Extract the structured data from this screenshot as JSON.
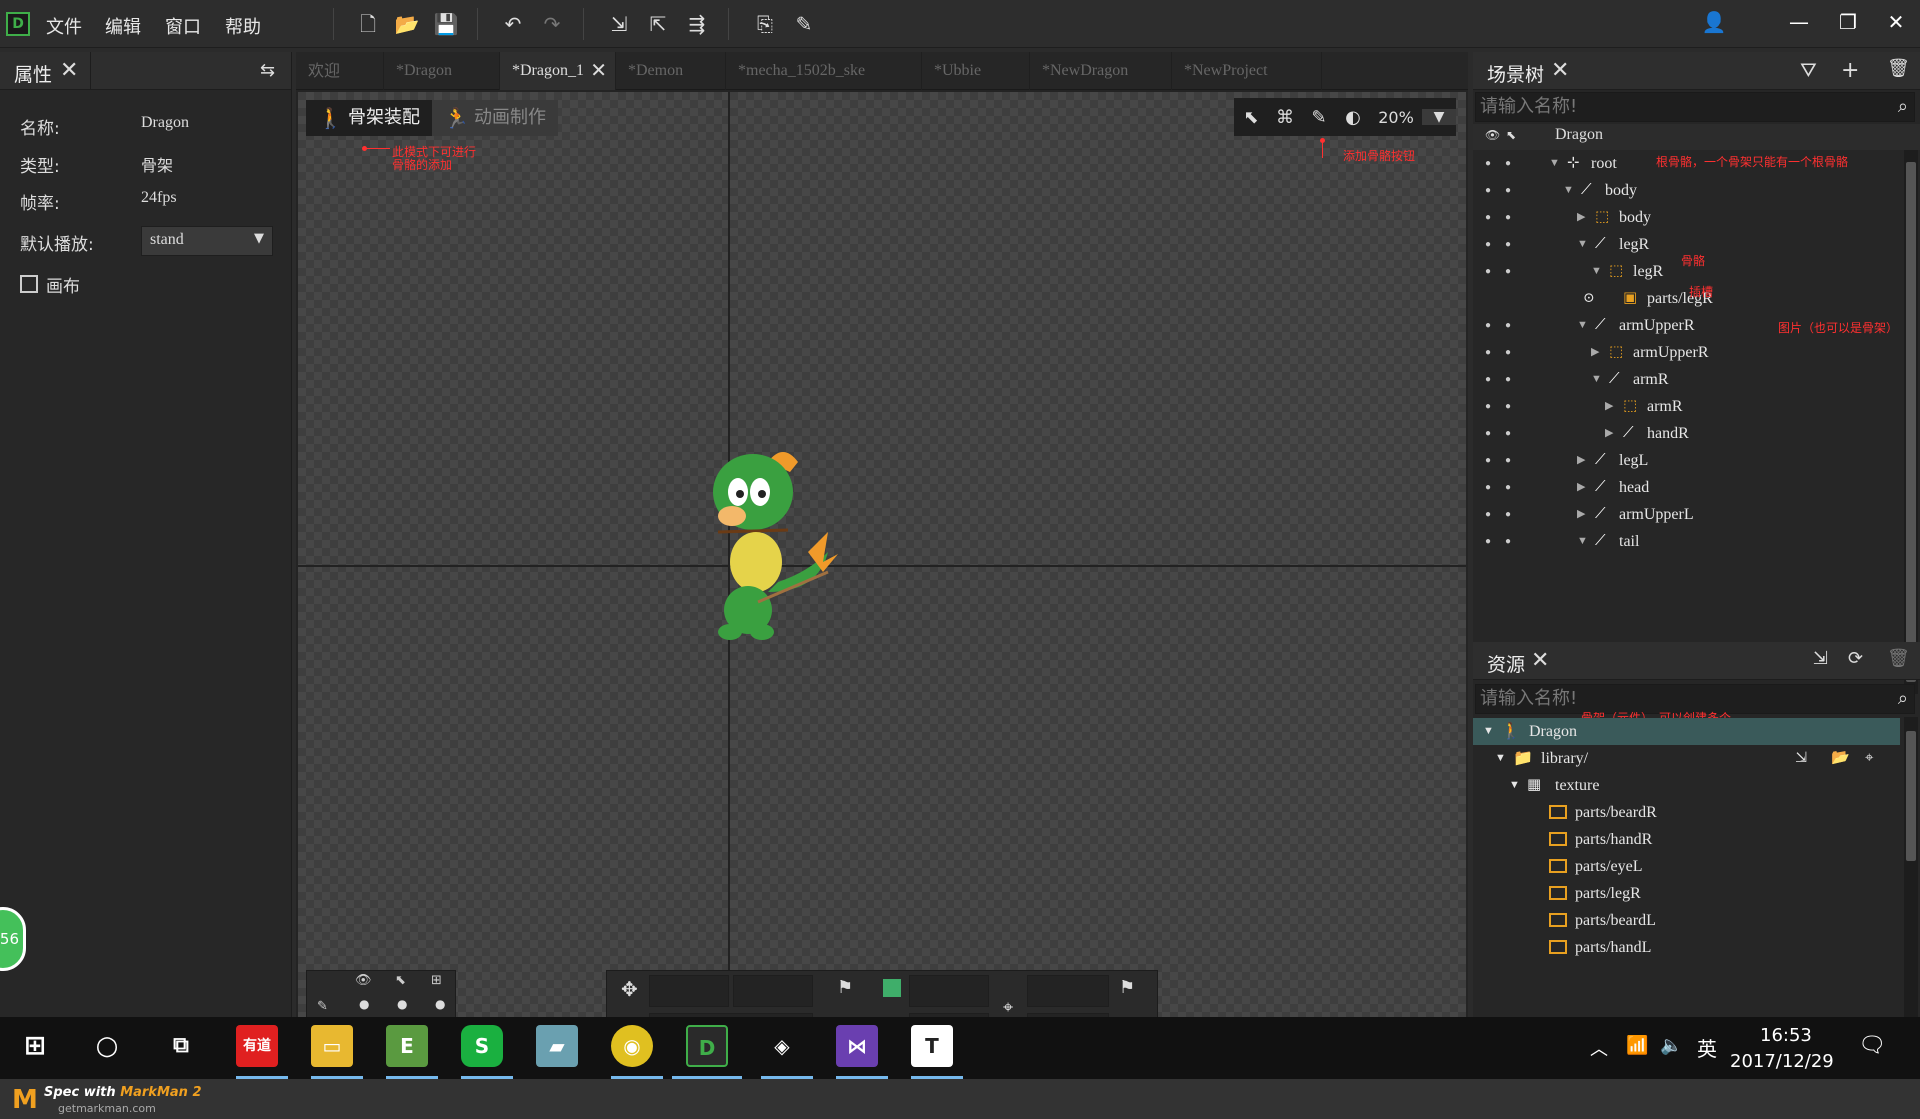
{
  "menu": {
    "file": "文件",
    "edit": "编辑",
    "window": "窗口",
    "help": "帮助"
  },
  "props": {
    "title": "属性",
    "name_label": "名称:",
    "name_value": "Dragon",
    "type_label": "类型:",
    "type_value": "骨架",
    "fps_label": "帧率:",
    "fps_value": "24fps",
    "play_label": "默认播放:",
    "play_value": "stand",
    "canvas_label": "画布",
    "badge": "56"
  },
  "tabs": [
    "欢迎",
    "*Dragon",
    "*Dragon_1",
    "*Demon",
    "*mecha_1502b_ske",
    "*Ubbie",
    "*NewDragon",
    "*NewProject"
  ],
  "modes": {
    "armature": "骨架装配",
    "animation": "动画制作"
  },
  "zoom": "20%",
  "annotations": {
    "mode_note_1": "此模式下可进行",
    "mode_note_2": "骨骼的添加",
    "add_bone": "添加骨骼按钮",
    "root_note": "根骨骼，一个骨架只能有一个根骨骼",
    "bone_note": "骨骼",
    "slot_note": "插槽",
    "image_note": "图片（也可以是骨架）",
    "armature_note": "骨架（元件），可以创建多个。"
  },
  "scene": {
    "title": "场景树",
    "search_placeholder": "请输入名称!",
    "root_name": "Dragon",
    "rows": [
      {
        "name": "root",
        "icon": "root"
      },
      {
        "name": "body",
        "icon": "bone"
      },
      {
        "name": "body",
        "icon": "slot"
      },
      {
        "name": "legR",
        "icon": "bone"
      },
      {
        "name": "legR",
        "icon": "slot"
      },
      {
        "name": "parts/legR",
        "icon": "image"
      },
      {
        "name": "armUpperR",
        "icon": "bone"
      },
      {
        "name": "armUpperR",
        "icon": "slot"
      },
      {
        "name": "armR",
        "icon": "bone"
      },
      {
        "name": "armR",
        "icon": "slot"
      },
      {
        "name": "handR",
        "icon": "bone"
      },
      {
        "name": "legL",
        "icon": "bone"
      },
      {
        "name": "head",
        "icon": "bone"
      },
      {
        "name": "armUpperL",
        "icon": "bone"
      },
      {
        "name": "tail",
        "icon": "bone"
      }
    ]
  },
  "resources": {
    "title": "资源",
    "search_placeholder": "请输入名称!",
    "rows": [
      {
        "name": "Dragon"
      },
      {
        "name": "library/"
      },
      {
        "name": "texture"
      },
      {
        "name": "parts/beardR"
      },
      {
        "name": "parts/handR"
      },
      {
        "name": "parts/eyeL"
      },
      {
        "name": "parts/legR"
      },
      {
        "name": "parts/beardL"
      },
      {
        "name": "parts/handL"
      }
    ]
  },
  "taskbar": {
    "youdao": "有道",
    "time": "16:53",
    "date": "2017/12/29",
    "ime": "英"
  },
  "footer": {
    "brand_pre": "Spec with ",
    "brand": "MarkMan 2",
    "url": "getmarkman.com"
  }
}
